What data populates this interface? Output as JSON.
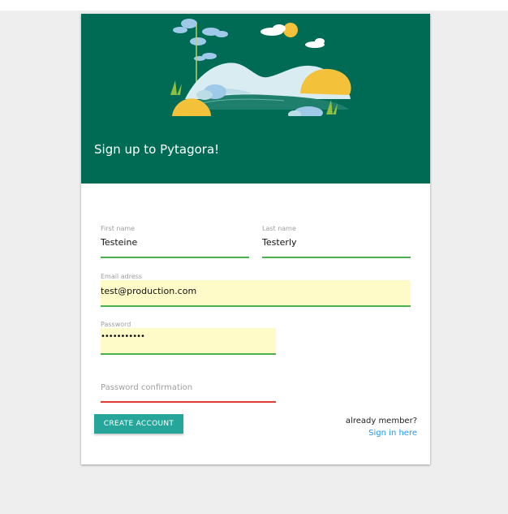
{
  "header": {
    "title": "Sign up to Pytagora!"
  },
  "form": {
    "first_name": {
      "label": "First name",
      "value": "Testeine"
    },
    "last_name": {
      "label": "Last name",
      "value": "Testerly"
    },
    "email": {
      "label": "Email adress",
      "value": "test@production.com"
    },
    "password": {
      "label": "Password",
      "value": "•••••••••••"
    },
    "password_confirmation": {
      "placeholder": "Password confirmation"
    }
  },
  "actions": {
    "create_account_label": "CREATE ACCOUNT",
    "already_member_text": "already member?",
    "sign_in_link": "Sign in here"
  },
  "colors": {
    "header_bg": "#006b55",
    "button_bg": "#26a69a",
    "valid_line": "#4caf50",
    "invalid_line": "#e53935",
    "autofill_bg": "#fffbc8",
    "link": "#2196f3"
  },
  "icons": [
    "clouds-icon",
    "sun-icon",
    "landscape-illustration"
  ]
}
